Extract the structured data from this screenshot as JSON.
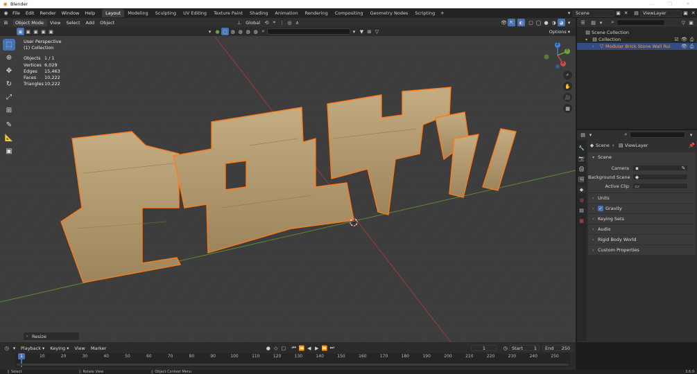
{
  "app": {
    "title": "Blender",
    "logo_icon": "blender-logo-icon"
  },
  "menus": [
    "File",
    "Edit",
    "Render",
    "Window",
    "Help"
  ],
  "workspaces": [
    "Layout",
    "Modeling",
    "Sculpting",
    "UV Editing",
    "Texture Paint",
    "Shading",
    "Animation",
    "Rendering",
    "Compositing",
    "Geometry Nodes",
    "Scripting"
  ],
  "active_workspace": "Layout",
  "scene_name": "Scene",
  "view_layer": "ViewLayer",
  "viewport_header": {
    "mode": "Object Mode",
    "menus": [
      "View",
      "Select",
      "Add",
      "Object"
    ],
    "orientation": "Global",
    "options": "Options"
  },
  "overlay_text": {
    "view": "User Perspective",
    "collection": "(1) Collection"
  },
  "stats": [
    {
      "label": "Objects",
      "value": "1 / 1"
    },
    {
      "label": "Vertices",
      "value": "6,029"
    },
    {
      "label": "Edges",
      "value": "15,463"
    },
    {
      "label": "Faces",
      "value": "10,222"
    },
    {
      "label": "Triangles",
      "value": "10,222"
    }
  ],
  "gizmo": {
    "x": "X",
    "y": "Y",
    "z": "Z"
  },
  "outliner": {
    "root": "Scene Collection",
    "collection": "Collection",
    "object": "Modular Brick Stone Wall Ruin Set I"
  },
  "properties": {
    "breadcrumb_scene": "Scene",
    "breadcrumb_layer": "ViewLayer",
    "panel_scene": "Scene",
    "camera_label": "Camera",
    "background_label": "Background Scene",
    "clip_label": "Active Clip",
    "panels": [
      "Units",
      "Gravity",
      "Keying Sets",
      "Audio",
      "Rigid Body World",
      "Custom Properties"
    ]
  },
  "resize_label": "Resize",
  "timeline": {
    "menus": [
      "Playback",
      "Keying",
      "View",
      "Marker"
    ],
    "current_frame": "1",
    "start_label": "Start",
    "start": "1",
    "end_label": "End",
    "end": "250",
    "ticks": [
      "1",
      "10",
      "20",
      "30",
      "40",
      "50",
      "60",
      "70",
      "80",
      "90",
      "100",
      "110",
      "120",
      "130",
      "140",
      "150",
      "160",
      "170",
      "180",
      "190",
      "200",
      "210",
      "220",
      "230",
      "240",
      "250"
    ]
  },
  "status": {
    "select": "Select",
    "rotate": "Rotate View",
    "context": "Object Context Menu",
    "version": "3.6.0"
  },
  "colors": {
    "accent": "#4772b3",
    "selection_outline": "#ff7a1a",
    "x_axis": "#c94a4a",
    "y_axis": "#6fa23a",
    "z_axis": "#3f7fd6"
  }
}
